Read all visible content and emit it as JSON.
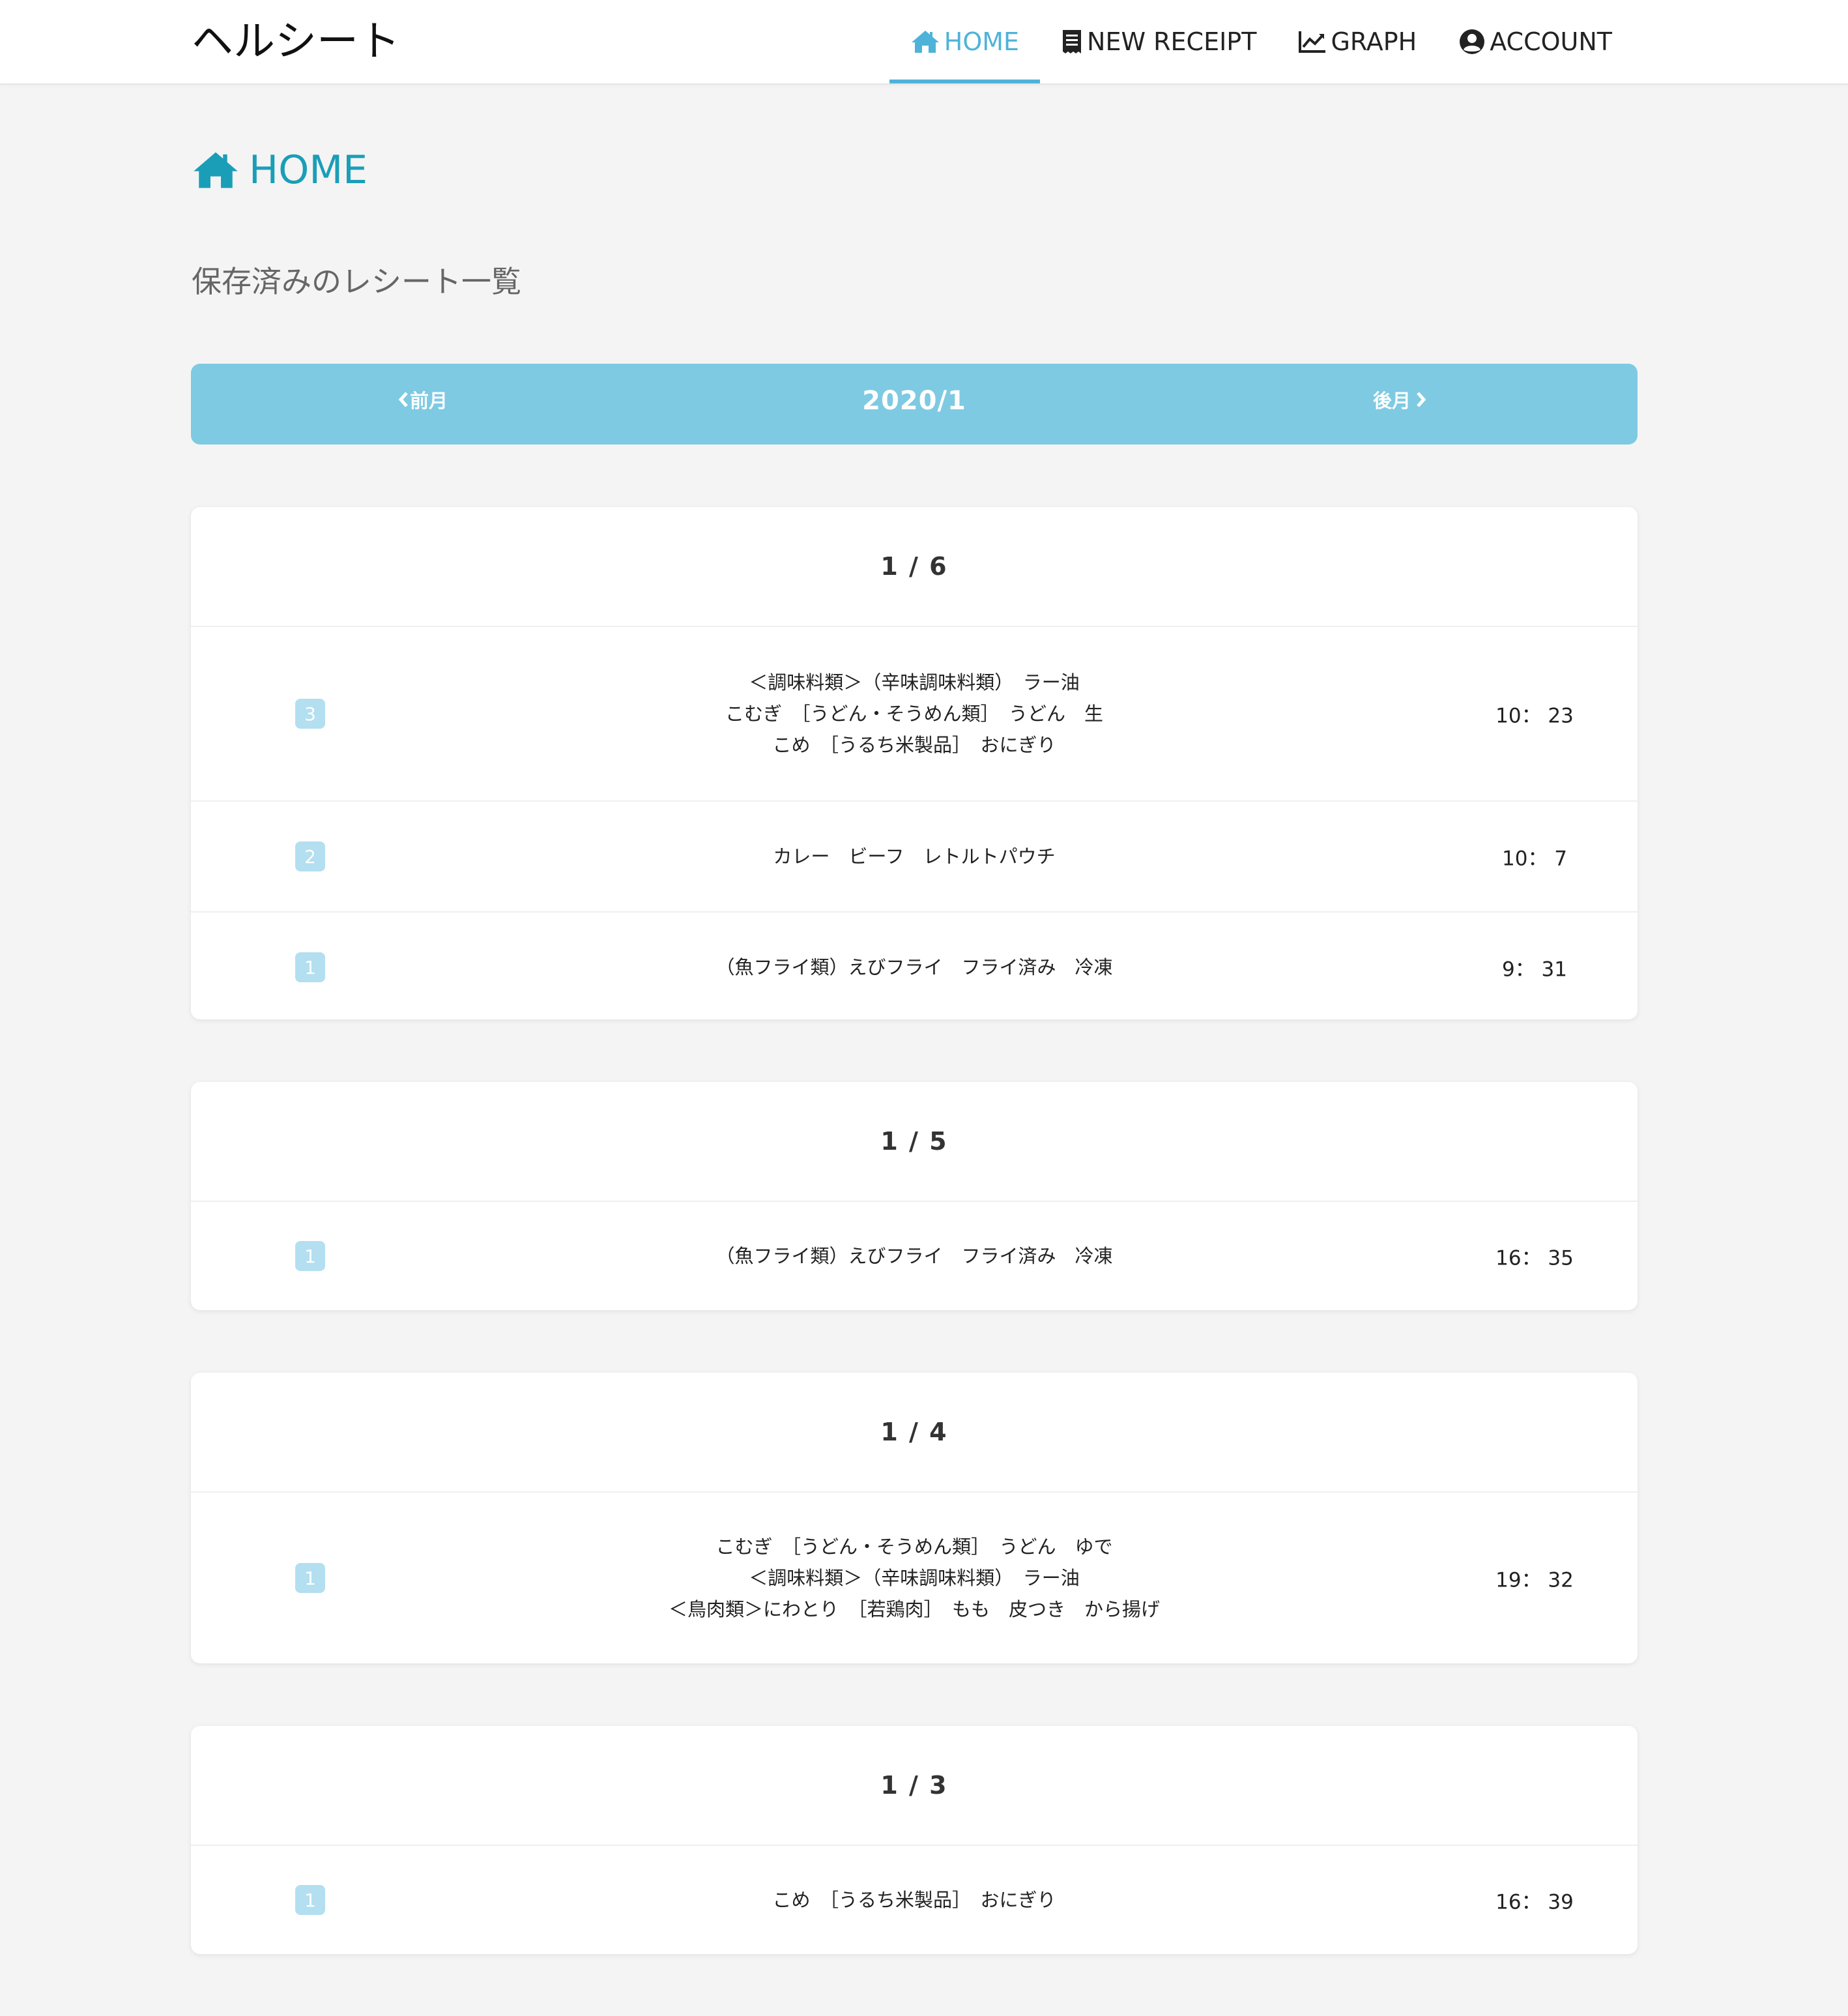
{
  "app": {
    "brand": "ヘルシート",
    "nav": [
      {
        "label": "HOME",
        "icon": "home-icon",
        "active": true
      },
      {
        "label": "NEW RECEIPT",
        "icon": "receipt-icon",
        "active": false
      },
      {
        "label": "GRAPH",
        "icon": "graph-icon",
        "active": false
      },
      {
        "label": "ACCOUNT",
        "icon": "account-icon",
        "active": false
      }
    ]
  },
  "colors": {
    "accent": "#4fb3d9",
    "title": "#1a9eb8",
    "month_bar": "#7ecae2",
    "badge": "#b3dff0",
    "background": "#f4f4f4"
  },
  "page": {
    "title": "HOME",
    "subtitle": "保存済みのレシート一覧"
  },
  "month": {
    "prev_label": "前月",
    "current": "2020/1",
    "next_label": "後月"
  },
  "days": [
    {
      "date": "1 / 6",
      "receipts": [
        {
          "count": "3",
          "items": [
            "＜調味料類＞（辛味調味料類）　ラー油",
            "こむぎ　［うどん・そうめん類］　うどん　生",
            "こめ　［うるち米製品］　おにぎり"
          ],
          "time": "10： 23"
        },
        {
          "count": "2",
          "items": [
            "カレー　ビーフ　レトルトパウチ"
          ],
          "time": "10： 7"
        },
        {
          "count": "1",
          "items": [
            "（魚フライ類）えびフライ　フライ済み　冷凍"
          ],
          "time": "9： 31"
        }
      ]
    },
    {
      "date": "1 / 5",
      "receipts": [
        {
          "count": "1",
          "items": [
            "（魚フライ類）えびフライ　フライ済み　冷凍"
          ],
          "time": "16： 35"
        }
      ]
    },
    {
      "date": "1 / 4",
      "receipts": [
        {
          "count": "1",
          "items": [
            "こむぎ　［うどん・そうめん類］　うどん　ゆで",
            "＜調味料類＞（辛味調味料類）　ラー油",
            "＜鳥肉類＞にわとり　［若鶏肉］　もも　皮つき　から揚げ"
          ],
          "time": "19： 32"
        }
      ]
    },
    {
      "date": "1 / 3",
      "receipts": [
        {
          "count": "1",
          "items": [
            "こめ　［うるち米製品］　おにぎり"
          ],
          "time": "16： 39"
        }
      ]
    }
  ]
}
